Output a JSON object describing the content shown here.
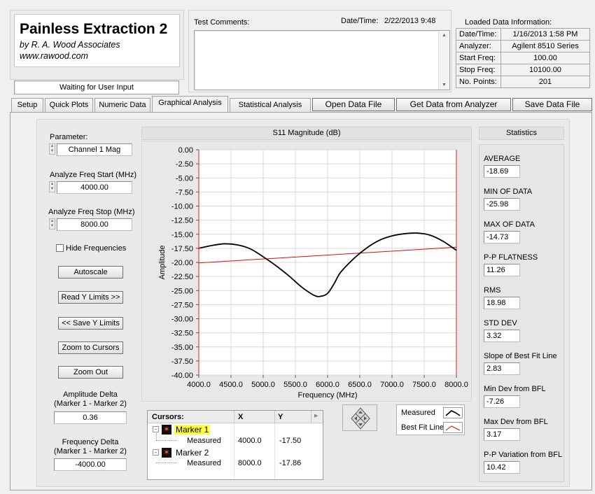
{
  "app": {
    "title": "Painless Extraction 2",
    "author": "by R. A. Wood Associates",
    "website": "www.rawood.com",
    "status": "Waiting for User Input"
  },
  "comments": {
    "label": "Test Comments:"
  },
  "datetime": {
    "label": "Date/Time:",
    "value": "2/22/2013  9:48"
  },
  "loaded": {
    "title": "Loaded Data Information:",
    "rows": [
      {
        "key": "Date/Time:",
        "value": "1/16/2013 1:58 PM"
      },
      {
        "key": "Analyzer:",
        "value": "Agilent 8510 Series"
      },
      {
        "key": "Start Freq:",
        "value": "100.00"
      },
      {
        "key": "Stop Freq:",
        "value": "10100.00"
      },
      {
        "key": "No. Points:",
        "value": "201"
      }
    ]
  },
  "tabs": [
    "Setup",
    "Quick Plots",
    "Numeric Data",
    "Graphical Analysis",
    "Statistical Analysis"
  ],
  "actions": {
    "open": "Open Data File",
    "get": "Get Data from Analyzer",
    "save": "Save Data File"
  },
  "left": {
    "parameter_label": "Parameter:",
    "parameter_value": "Channel 1 Mag",
    "start_label": "Analyze Freq Start (MHz)",
    "start_value": "4000.00",
    "stop_label": "Analyze Freq Stop (MHz)",
    "stop_value": "8000.00",
    "hide_freq": "Hide Frequencies",
    "autoscale": "Autoscale",
    "read_y": "Read Y Limits >>",
    "save_y": "<< Save Y Limits",
    "zoom_cursors": "Zoom to Cursors",
    "zoom_out": "Zoom Out",
    "amp_delta_label1": "Amplitude Delta",
    "amp_delta_label2": "(Marker 1 - Marker 2)",
    "amp_delta_value": "0.36",
    "freq_delta_label1": "Frequency Delta",
    "freq_delta_label2": "(Marker 1 - Marker 2)",
    "freq_delta_value": "-4000.00"
  },
  "cursors": {
    "headers": [
      "Cursors:",
      "X",
      "Y"
    ],
    "rows": [
      {
        "name": "Marker 1",
        "x": "",
        "y": ""
      },
      {
        "name": "Measured",
        "x": "4000.0",
        "y": "-17.50"
      },
      {
        "name": "Marker 2",
        "x": "",
        "y": ""
      },
      {
        "name": "Measured",
        "x": "8000.0",
        "y": "-17.86"
      }
    ]
  },
  "legend": {
    "measured": "Measured",
    "bestfit": "Best Fit Line"
  },
  "stats": {
    "title": "Statistics",
    "items": [
      {
        "label": "AVERAGE",
        "value": "-18.69"
      },
      {
        "label": "MIN OF DATA",
        "value": "-25.98"
      },
      {
        "label": "MAX OF DATA",
        "value": "-14.73"
      },
      {
        "label": "P-P FLATNESS",
        "value": "11.26"
      },
      {
        "label": "RMS",
        "value": "18.98"
      },
      {
        "label": "STD DEV",
        "value": "3.32"
      },
      {
        "label": "Slope of Best Fit Line",
        "value": "2.83"
      },
      {
        "label": "Min Dev from BFL",
        "value": "-7.26"
      },
      {
        "label": "Max Dev from BFL",
        "value": "3.17"
      },
      {
        "label": "P-P Variation from BFL",
        "value": "10.42"
      }
    ]
  },
  "colors": {
    "measured": "#000000",
    "bestfit": "#d01010",
    "cursor": "#e02020",
    "highlight": "#ffff40"
  },
  "chart_data": {
    "type": "line",
    "title": "S11 Magnitude (dB)",
    "xlabel": "Frequency (MHz)",
    "ylabel": "Amplitude",
    "xlim": [
      4000,
      8000
    ],
    "ylim": [
      -40,
      0
    ],
    "xticks": [
      "4000.0",
      "4500.0",
      "5000.0",
      "5500.0",
      "6000.0",
      "6500.0",
      "7000.0",
      "7500.0",
      "8000.0"
    ],
    "yticks": [
      "0.00",
      "-2.50",
      "-5.00",
      "-7.50",
      "-10.00",
      "-12.50",
      "-15.00",
      "-17.50",
      "-20.00",
      "-22.50",
      "-25.00",
      "-27.50",
      "-30.00",
      "-32.50",
      "-35.00",
      "-37.50",
      "-40.00"
    ],
    "series": [
      {
        "name": "Measured",
        "x": [
          4000,
          4200,
          4400,
          4600,
          4800,
          5000,
          5200,
          5400,
          5600,
          5800,
          5900,
          6000,
          6100,
          6200,
          6400,
          6600,
          6800,
          7000,
          7200,
          7400,
          7600,
          7800,
          8000
        ],
        "y": [
          -17.5,
          -17.0,
          -16.7,
          -16.9,
          -17.6,
          -19.0,
          -20.6,
          -22.4,
          -24.4,
          -25.9,
          -26.0,
          -25.5,
          -23.8,
          -21.8,
          -19.4,
          -17.5,
          -16.1,
          -15.3,
          -14.9,
          -14.8,
          -15.2,
          -16.3,
          -17.86
        ]
      },
      {
        "name": "Best Fit Line",
        "x": [
          4000,
          8000
        ],
        "y": [
          -20.1,
          -17.3
        ]
      }
    ],
    "cursors_x": [
      4000,
      8000
    ]
  }
}
